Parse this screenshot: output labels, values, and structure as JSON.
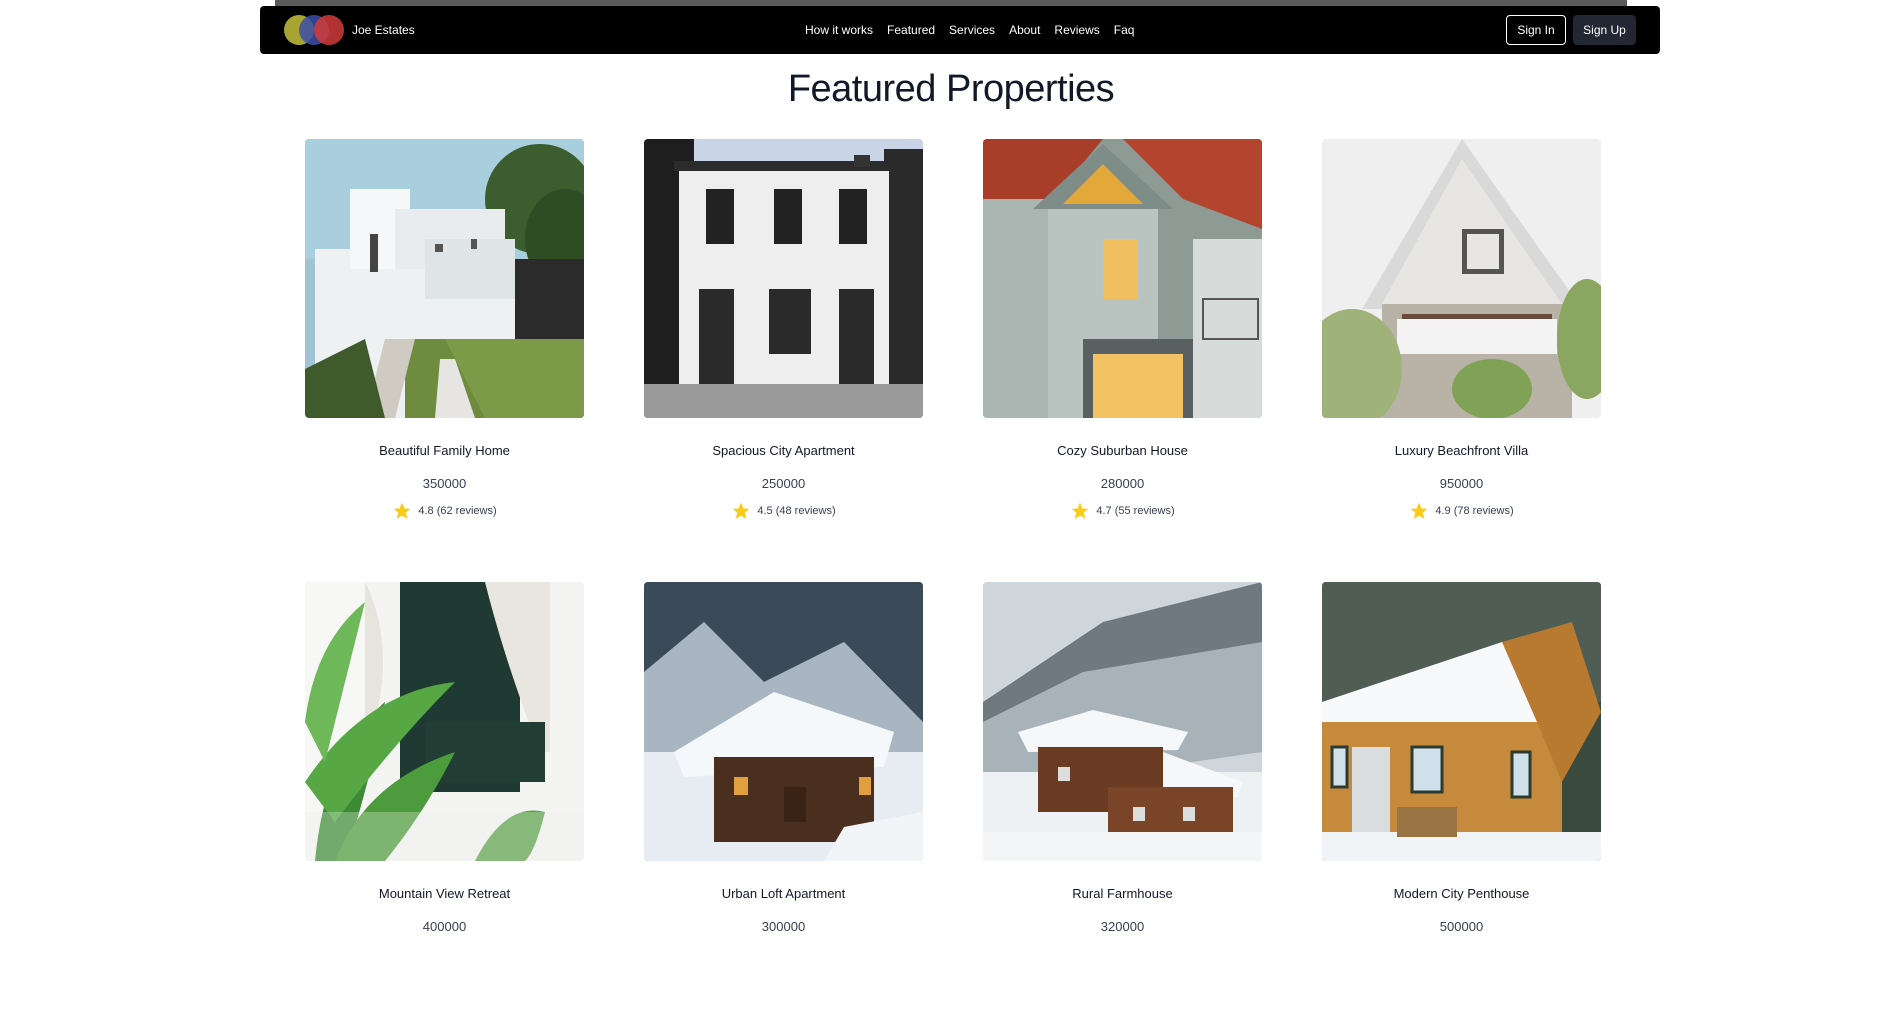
{
  "nav": {
    "brand": "Joe Estates",
    "links": [
      "How it works",
      "Featured",
      "Services",
      "About",
      "Reviews",
      "Faq"
    ],
    "signin": "Sign In",
    "signup": "Sign Up"
  },
  "title": "Featured Properties",
  "properties": [
    {
      "name": "Beautiful Family Home",
      "price": "350000",
      "rating": "4.8 (62 reviews)",
      "image": "white-modern-house"
    },
    {
      "name": "Spacious City Apartment",
      "price": "250000",
      "rating": "4.5 (48 reviews)",
      "image": "white-brick-townhouse"
    },
    {
      "name": "Cozy Suburban House",
      "price": "280000",
      "rating": "4.7 (55 reviews)",
      "image": "grey-gabled-house"
    },
    {
      "name": "Luxury Beachfront Villa",
      "price": "950000",
      "rating": "4.9 (78 reviews)",
      "image": "white-a-frame-cottage"
    },
    {
      "name": "Mountain View Retreat",
      "price": "400000",
      "rating": "",
      "image": "palm-balcony"
    },
    {
      "name": "Urban Loft Apartment",
      "price": "300000",
      "rating": "",
      "image": "snowy-mountain-chalet"
    },
    {
      "name": "Rural Farmhouse",
      "price": "320000",
      "rating": "",
      "image": "snowy-valley-cabin"
    },
    {
      "name": "Modern City Penthouse",
      "price": "500000",
      "rating": "",
      "image": "snowy-log-cabin"
    }
  ],
  "colors": {
    "navbar": "#000000",
    "signup_bg": "#222733",
    "star": "#facc15"
  }
}
